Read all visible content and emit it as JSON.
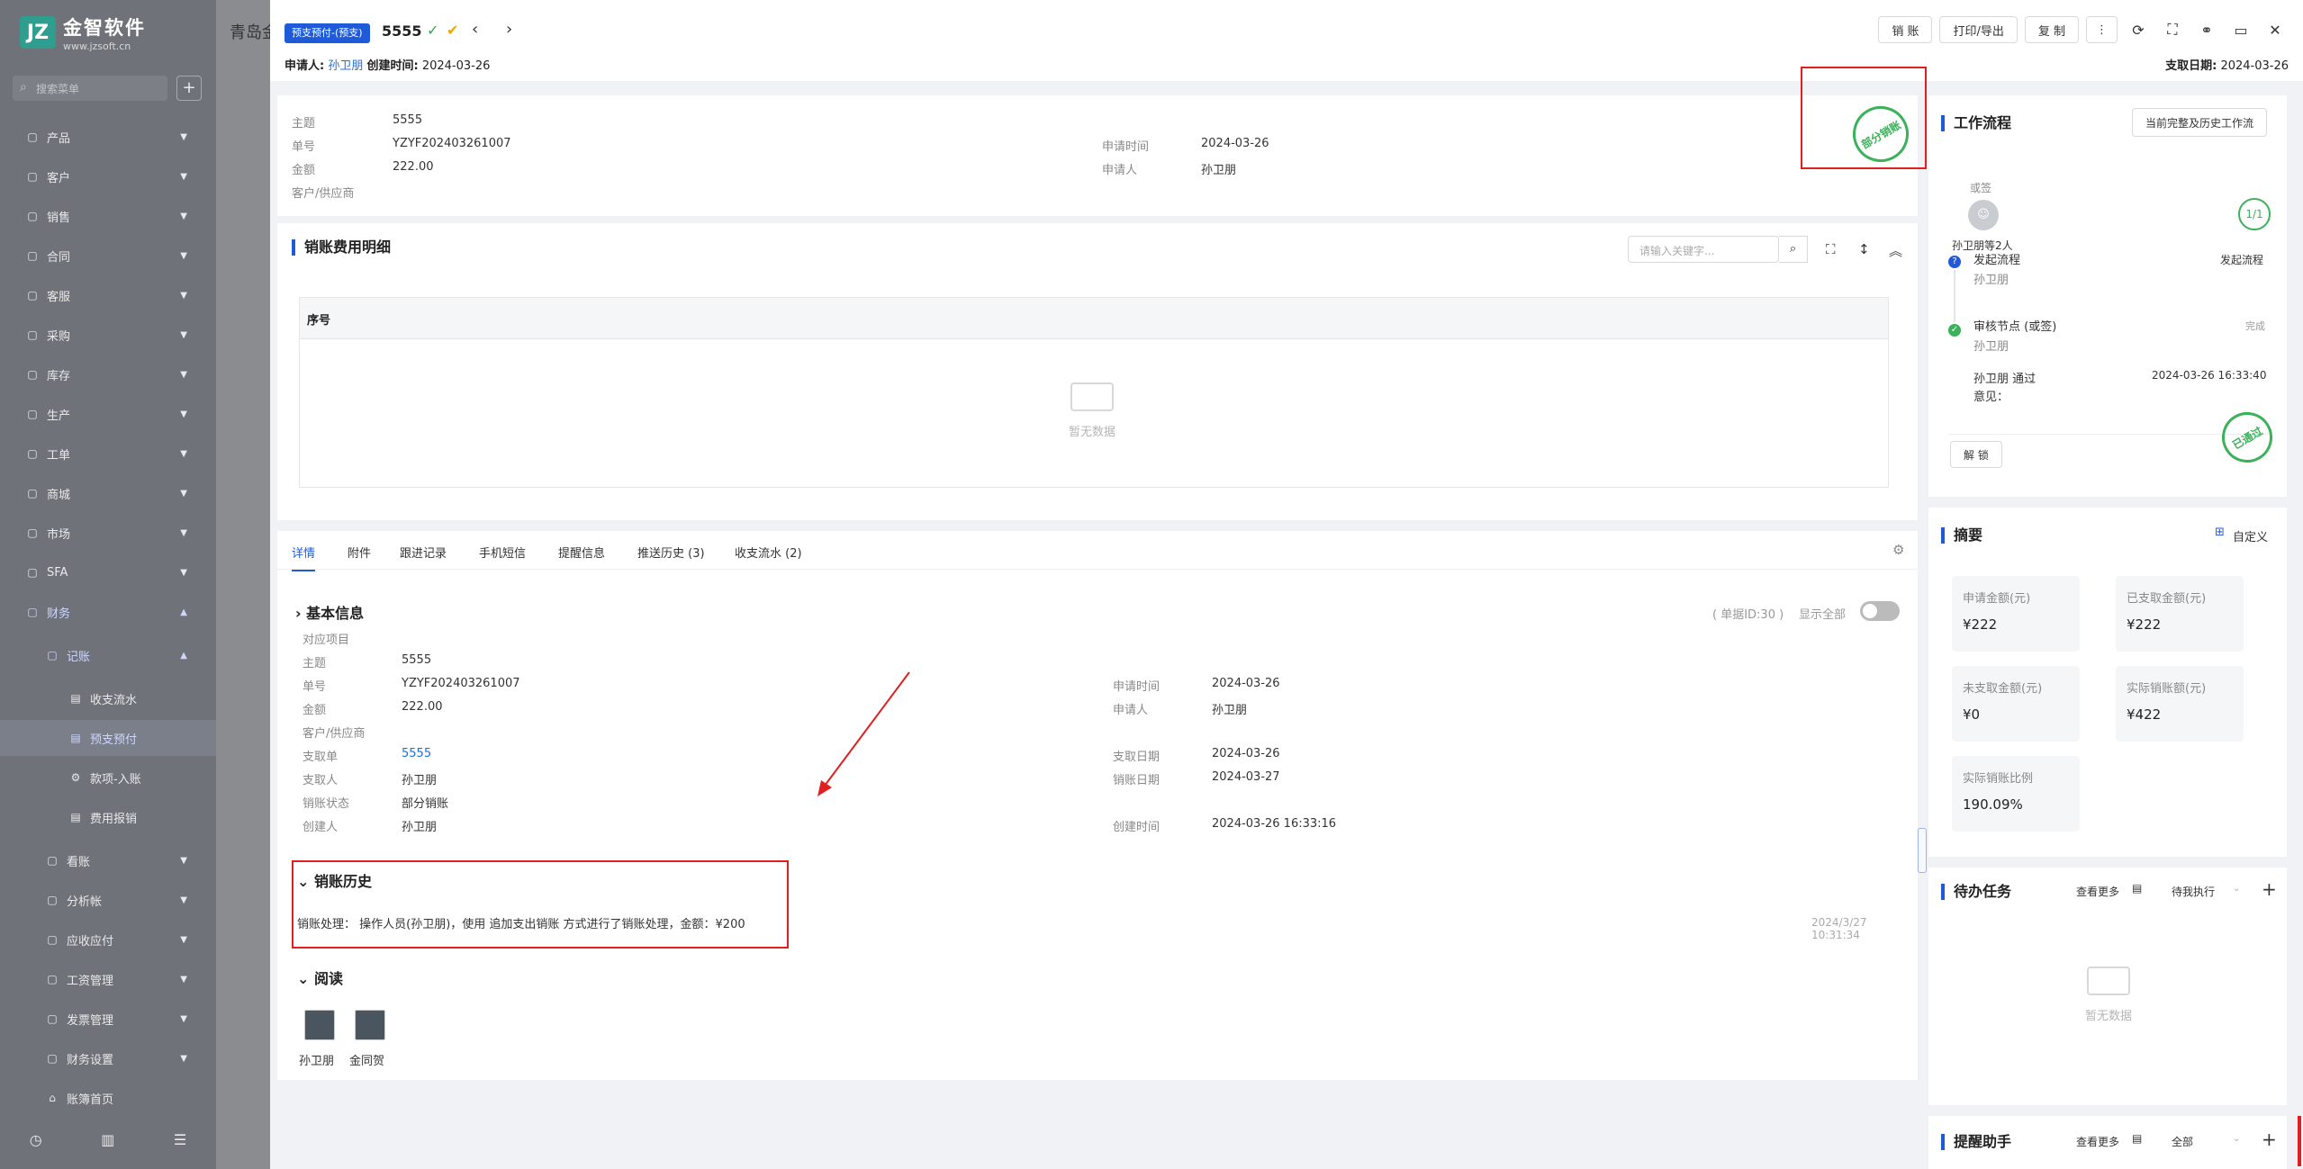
{
  "sidebar": {
    "logo_mark": "JZ",
    "logo_name": "金智软件",
    "logo_url": "www.jzsoft.cn",
    "search_placeholder": "搜索菜单",
    "items": [
      {
        "label": "产品",
        "icon": "product-icon"
      },
      {
        "label": "客户",
        "icon": "customer-icon"
      },
      {
        "label": "销售",
        "icon": "sales-icon"
      },
      {
        "label": "合同",
        "icon": "contract-icon"
      },
      {
        "label": "客服",
        "icon": "service-icon"
      },
      {
        "label": "采购",
        "icon": "purchase-icon"
      },
      {
        "label": "库存",
        "icon": "inventory-icon"
      },
      {
        "label": "生产",
        "icon": "production-icon"
      },
      {
        "label": "工单",
        "icon": "workorder-icon"
      },
      {
        "label": "商城",
        "icon": "mall-icon"
      },
      {
        "label": "市场",
        "icon": "market-icon"
      },
      {
        "label": "SFA",
        "icon": "sfa-icon"
      },
      {
        "label": "财务",
        "icon": "finance-icon"
      }
    ],
    "finance_sub": [
      {
        "label": "记账"
      },
      {
        "label": "收支流水"
      },
      {
        "label": "预支预付"
      },
      {
        "label": "款项-入账"
      },
      {
        "label": "费用报销"
      },
      {
        "label": "看账"
      },
      {
        "label": "分析帐"
      },
      {
        "label": "应收应付"
      },
      {
        "label": "工资管理"
      },
      {
        "label": "发票管理"
      },
      {
        "label": "财务设置"
      },
      {
        "label": "账簿首页"
      }
    ]
  },
  "background_page": {
    "title": "青岛金"
  },
  "drawer": {
    "tag": "预支预付-(预支)",
    "doc_no": "5555",
    "applicant_label": "申请人:",
    "applicant": "孙卫朋",
    "created_label": "创建时间:",
    "created": "2024-03-26",
    "pay_date_label": "支取日期:",
    "pay_date": "2024-03-26",
    "toolbar": {
      "writeoff": "销 账",
      "print": "打印/导出",
      "copy": "复 制"
    }
  },
  "summary": {
    "subject_l": "主题",
    "subject": "5555",
    "no_l": "单号",
    "no": "YZYF202403261007",
    "amount_l": "金额",
    "amount": "222.00",
    "partner_l": "客户/供应商",
    "apply_time_l": "申请时间",
    "apply_time": "2024-03-26",
    "applicant_l": "申请人",
    "applicant": "孙卫朋",
    "stamp": "部分销账"
  },
  "detail_table": {
    "title": "销账费用明细",
    "search_placeholder": "请输入关键字...",
    "col_no": "序号",
    "empty": "暂无数据"
  },
  "tabs": [
    "详情",
    "附件",
    "跟进记录",
    "手机短信",
    "提醒信息",
    "推送历史 (3)",
    "收支流水 (2)"
  ],
  "basic": {
    "title": "基本信息",
    "doc_id": "( 单据ID:30 )",
    "show_all": "显示全部",
    "project_l": "对应项目",
    "subject_l": "主题",
    "subject": "5555",
    "no_l": "单号",
    "no": "YZYF202403261007",
    "amount_l": "金额",
    "amount": "222.00",
    "partner_l": "客户/供应商",
    "pay_doc_l": "支取单",
    "pay_doc": "5555",
    "payer_l": "支取人",
    "payer": "孙卫朋",
    "status_l": "销账状态",
    "status": "部分销账",
    "creator_l": "创建人",
    "creator": "孙卫朋",
    "apply_time_l": "申请时间",
    "apply_time": "2024-03-26",
    "applicant_l": "申请人",
    "applicant": "孙卫朋",
    "pay_date_l": "支取日期",
    "pay_date": "2024-03-26",
    "writeoff_date_l": "销账日期",
    "writeoff_date": "2024-03-27",
    "create_time_l": "创建时间",
    "create_time": "2024-03-26 16:33:16"
  },
  "history": {
    "title": "销账历史",
    "entry": "销账处理： 操作人员(孙卫朋)，使用 追加支出销账 方式进行了销账处理，金额：¥200",
    "time": "2024/3/27 10:31:34"
  },
  "read": {
    "title": "阅读",
    "users": [
      "孙卫朋",
      "金同贺"
    ]
  },
  "workflow": {
    "title": "工作流程",
    "history_btn": "当前完整及历史工作流",
    "sign_label": "或签",
    "sign_people": "孙卫朋等2人",
    "progress": "1/1",
    "start_label": "发起流程",
    "start_right": "发起流程",
    "start_user": "孙卫朋",
    "node_label": "审核节点 (或签)",
    "node_status": "完成",
    "node_user": "孙卫朋",
    "pass_text": "孙卫朋 通过",
    "pass_time": "2024-03-26 16:33:40",
    "opinion": "意见：",
    "unlock": "解 锁",
    "stamp": "已通过"
  },
  "abstract": {
    "title": "摘要",
    "customize": "自定义",
    "stats": [
      {
        "label": "申请金额(元)",
        "value": "¥222"
      },
      {
        "label": "已支取金额(元)",
        "value": "¥222"
      },
      {
        "label": "未支取金额(元)",
        "value": "¥0"
      },
      {
        "label": "实际销账额(元)",
        "value": "¥422"
      },
      {
        "label": "实际销账比例",
        "value": "190.09%"
      }
    ]
  },
  "todo": {
    "title": "待办任务",
    "more": "查看更多",
    "filter": "待我执行",
    "empty": "暂无数据"
  },
  "reminder": {
    "title": "提醒助手",
    "more": "查看更多",
    "filter": "全部"
  },
  "colors": {
    "accent": "#1f5bd8",
    "stamp_green": "#3bb15a",
    "highlight_red": "#e02020"
  }
}
